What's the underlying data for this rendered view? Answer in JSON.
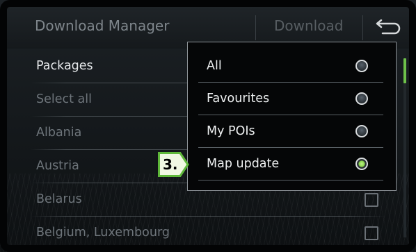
{
  "header": {
    "title": "Download Manager",
    "download_label": "Download",
    "back_icon": "return-arrow-icon"
  },
  "list": {
    "items": [
      {
        "label": "Packages",
        "active": true
      },
      {
        "label": "Select all"
      },
      {
        "label": "Albania"
      },
      {
        "label": "Austria"
      },
      {
        "label": "Belarus",
        "checkbox": true,
        "checked": false
      },
      {
        "label": "Belgium, Luxembourg",
        "checkbox": true,
        "checked": false
      }
    ]
  },
  "popup": {
    "options": [
      {
        "label": "All",
        "selected": false
      },
      {
        "label": "Favourites",
        "selected": false
      },
      {
        "label": "My POIs",
        "selected": false
      },
      {
        "label": "Map update",
        "selected": true
      }
    ]
  },
  "callout": {
    "label": "3."
  },
  "colors": {
    "accent_green": "#8ad64c",
    "callout_border": "#5fb83a",
    "callout_fill": "#f1f8e3"
  }
}
